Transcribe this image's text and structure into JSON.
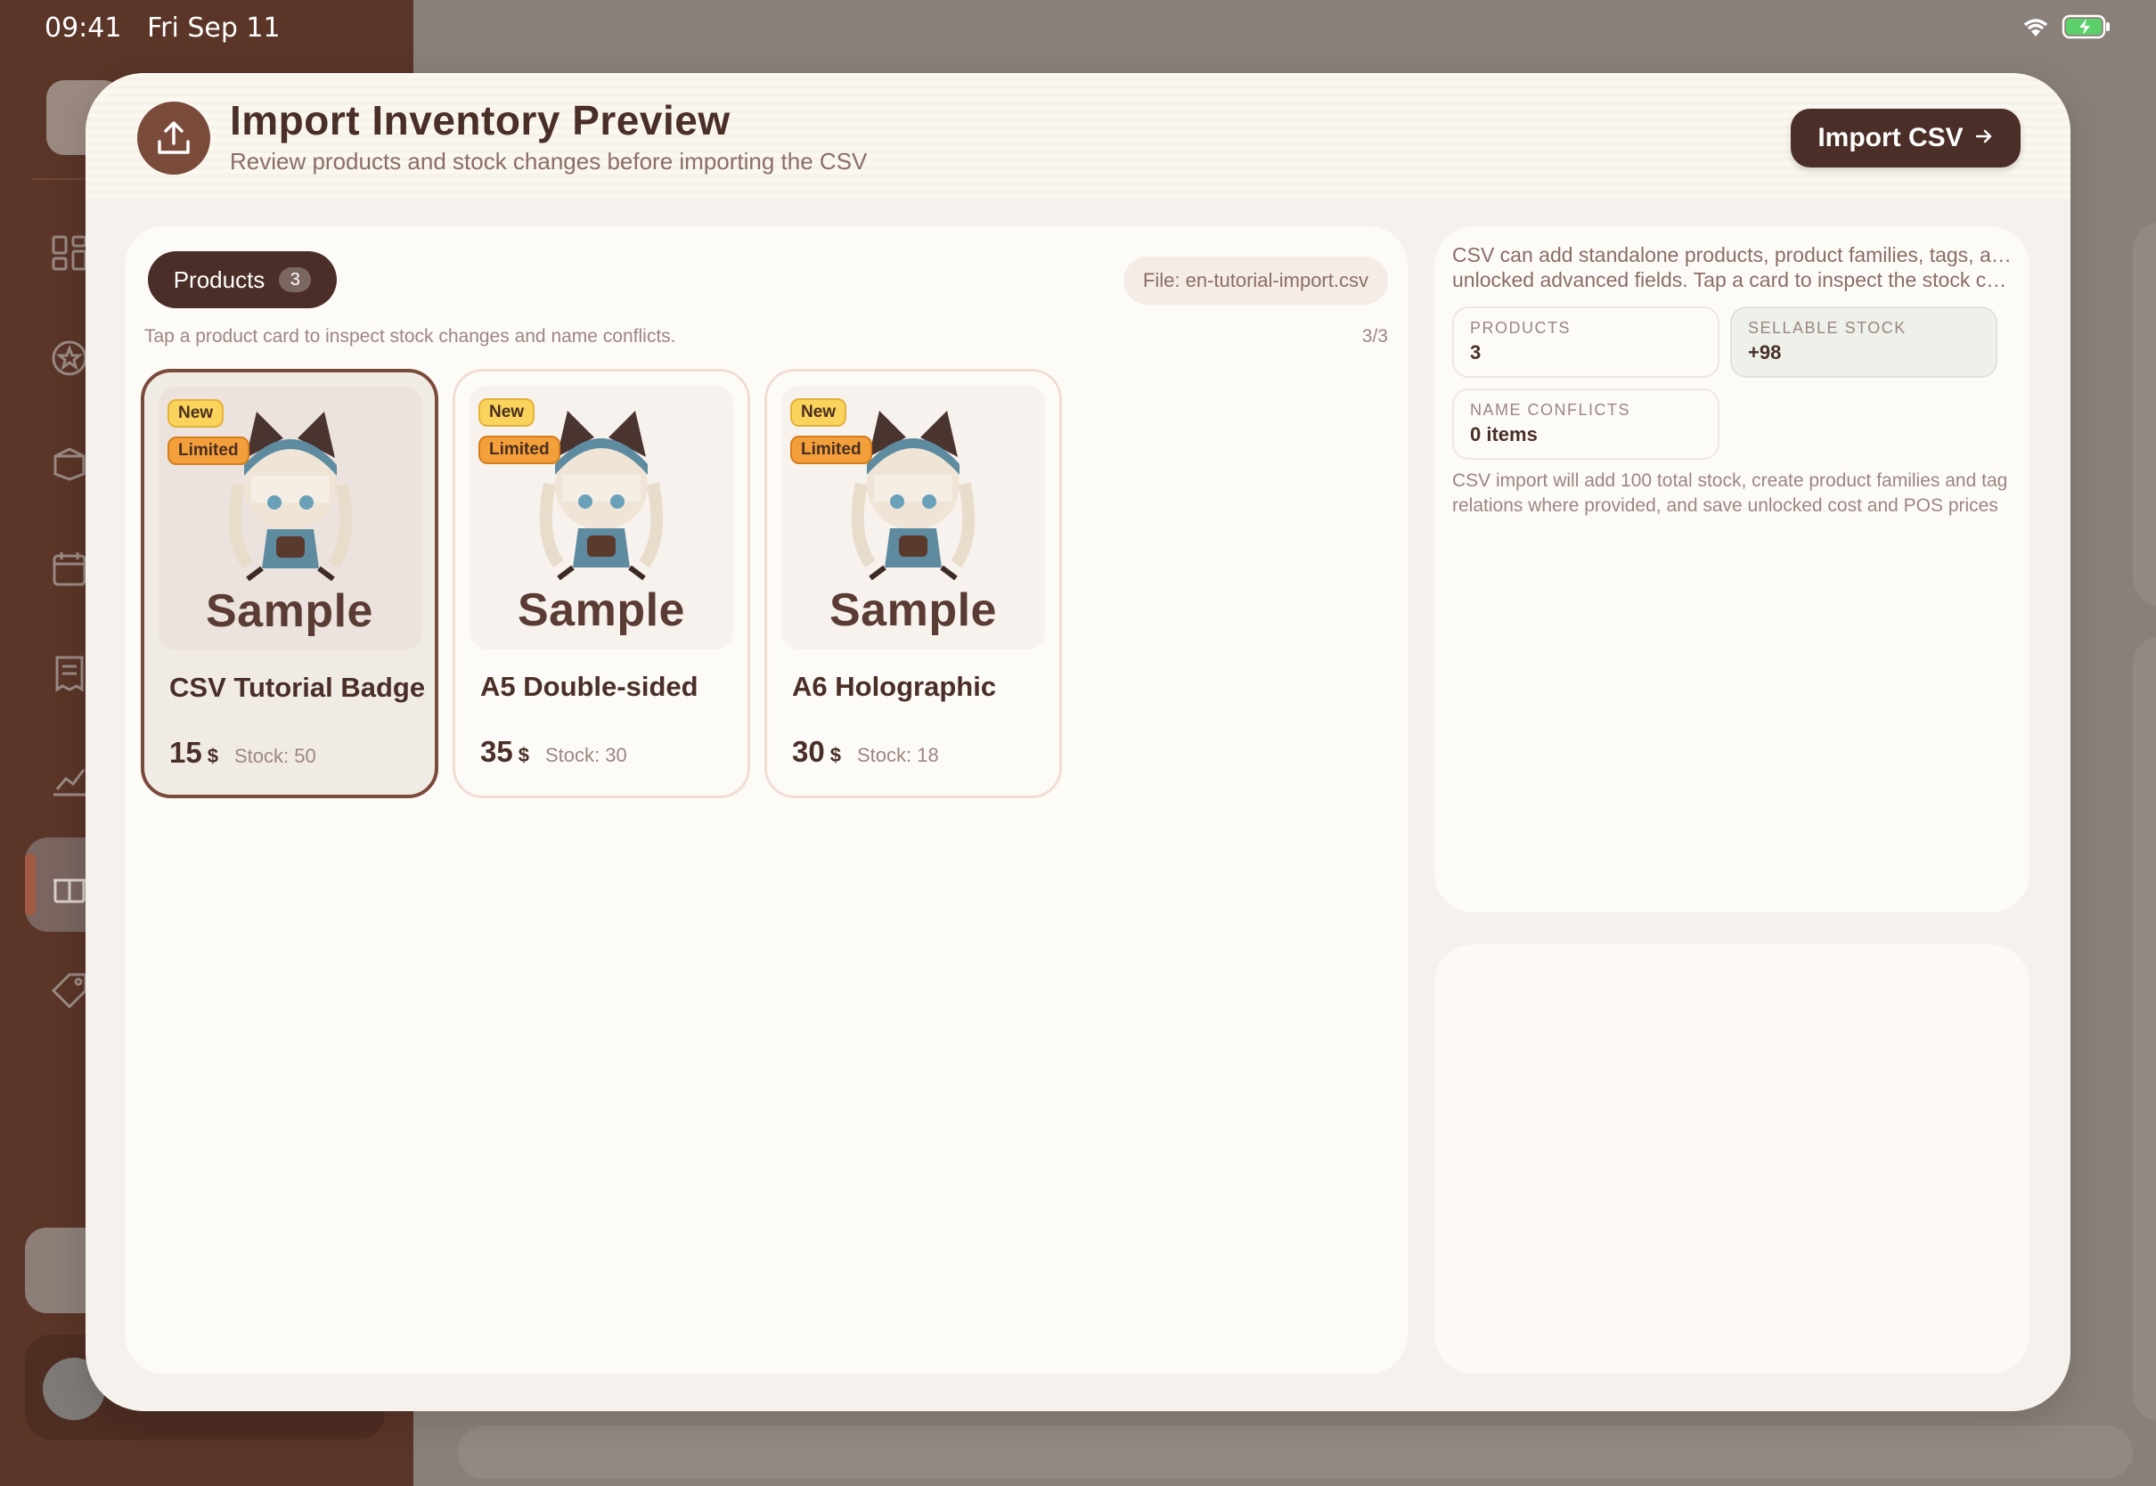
{
  "status_bar": {
    "time": "09:41",
    "date": "Fri Sep 11"
  },
  "modal": {
    "title": "Import Inventory Preview",
    "subtitle": "Review products and stock changes before importing the CSV",
    "import_button": "Import CSV"
  },
  "products_panel": {
    "tab_label": "Products",
    "tab_count": "3",
    "file_chip": "File: en-tutorial-import.csv",
    "hint": "Tap a product card to inspect stock changes and name conflicts.",
    "page_count": "3/3",
    "cards": [
      {
        "name": "CSV Tutorial Badge",
        "price": "15",
        "currency": "$",
        "stock": "Stock: 50",
        "badges": [
          "New",
          "Limited"
        ],
        "image_text": "Sample",
        "selected": true
      },
      {
        "name": "A5 Double-sided",
        "price": "35",
        "currency": "$",
        "stock": "Stock: 30",
        "badges": [
          "New",
          "Limited"
        ],
        "image_text": "Sample",
        "selected": false
      },
      {
        "name": "A6 Holographic",
        "price": "30",
        "currency": "$",
        "stock": "Stock: 18",
        "badges": [
          "New",
          "Limited"
        ],
        "image_text": "Sample",
        "selected": false
      }
    ]
  },
  "summary_panel": {
    "description_line1": "CSV can add standalone products, product families, tags, and",
    "description_line2": "unlocked advanced fields. Tap a card to inspect the stock changes",
    "stats": {
      "products_label": "PRODUCTS",
      "products_value": "3",
      "sellable_label": "SELLABLE STOCK",
      "sellable_value": "+98",
      "conflicts_label": "NAME CONFLICTS",
      "conflicts_value": "0 items"
    },
    "note_line1": "CSV import will add 100 total stock, create product families and tag",
    "note_line2": "relations where provided, and save unlocked cost and POS prices"
  },
  "colors": {
    "primary_dark": "#4b2e27",
    "accent_brown": "#7a4a3a",
    "badge_new": "#f9d35b",
    "badge_limited": "#f3a03c",
    "modal_bg": "#f5f1ec",
    "sidebar_bg": "#5a3528"
  },
  "icons": [
    "upload-icon",
    "arrow-right-icon",
    "wifi-icon",
    "battery-icon",
    "dashboard-icon",
    "star-icon",
    "box-icon",
    "calendar-icon",
    "receipt-icon",
    "chart-icon",
    "gift-icon",
    "tag-icon"
  ]
}
